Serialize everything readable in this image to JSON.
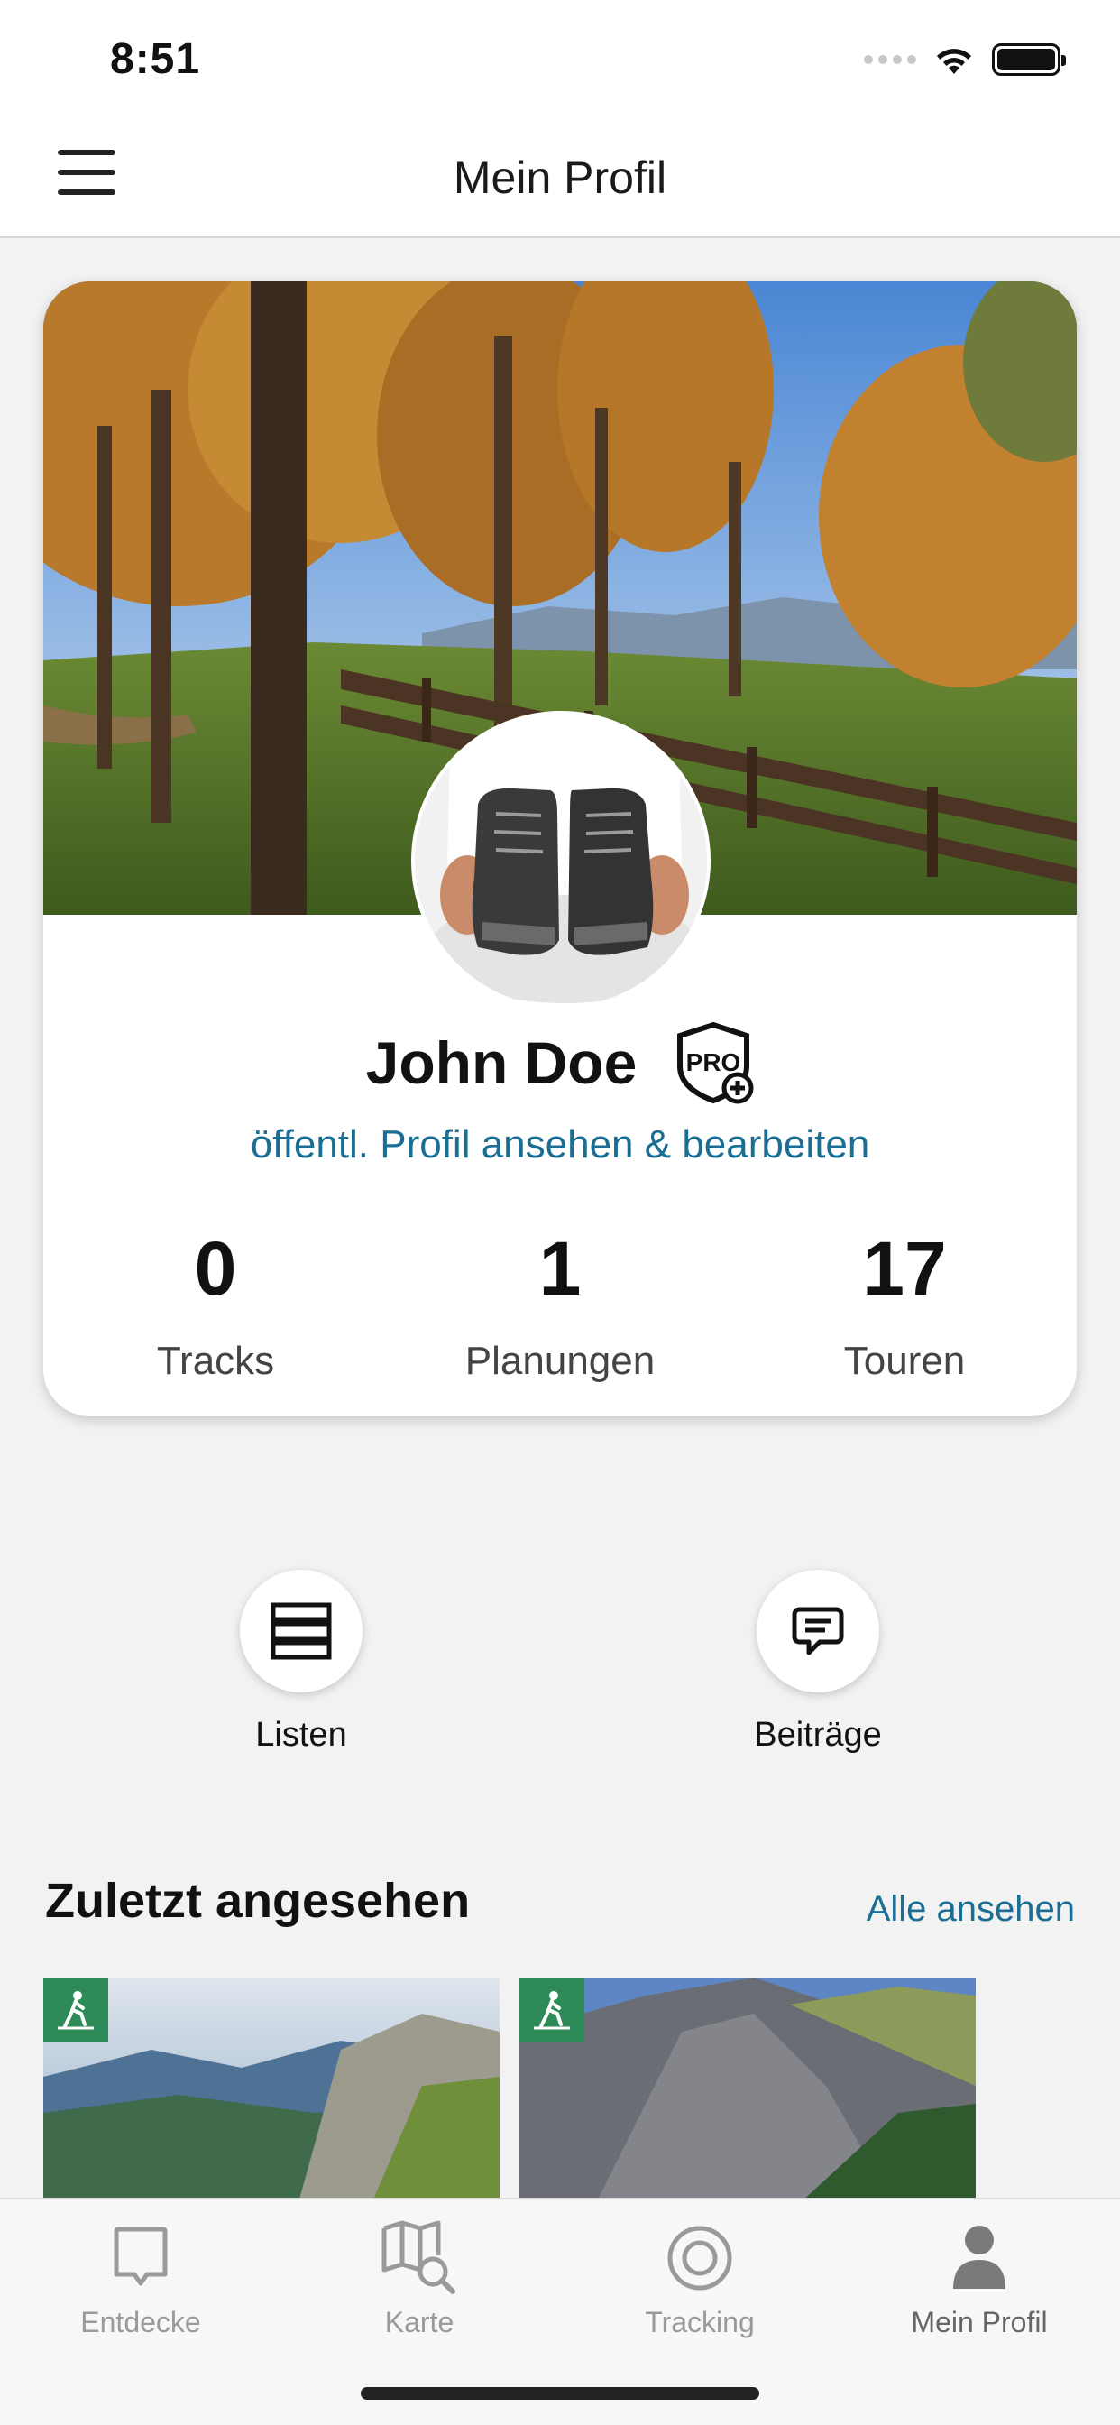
{
  "status_bar": {
    "time": "8:51"
  },
  "nav": {
    "title": "Mein Profil",
    "menu_icon": "hamburger-icon"
  },
  "profile": {
    "name": "John Doe",
    "badge": "PRO",
    "link_text": "öffentl. Profil ansehen & bearbeiten",
    "stats": [
      {
        "value": "0",
        "label": "Tracks"
      },
      {
        "value": "1",
        "label": "Planungen"
      },
      {
        "value": "17",
        "label": "Touren"
      }
    ]
  },
  "quick_actions": [
    {
      "label": "Listen",
      "icon": "list-icon"
    },
    {
      "label": "Beiträge",
      "icon": "comment-icon"
    }
  ],
  "recent": {
    "title": "Zuletzt angesehen",
    "see_all": "Alle ansehen",
    "items": [
      {
        "type_icon": "hiking-icon"
      },
      {
        "type_icon": "hiking-icon"
      }
    ]
  },
  "tabs": [
    {
      "label": "Entdecke",
      "icon": "discover-icon",
      "active": false
    },
    {
      "label": "Karte",
      "icon": "map-search-icon",
      "active": false
    },
    {
      "label": "Tracking",
      "icon": "tracking-icon",
      "active": false
    },
    {
      "label": "Mein Profil",
      "icon": "profile-icon",
      "active": true
    }
  ],
  "colors": {
    "link": "#1a6e93",
    "badge_green": "#2e8b57",
    "tab_inactive": "#9a9a9a"
  }
}
